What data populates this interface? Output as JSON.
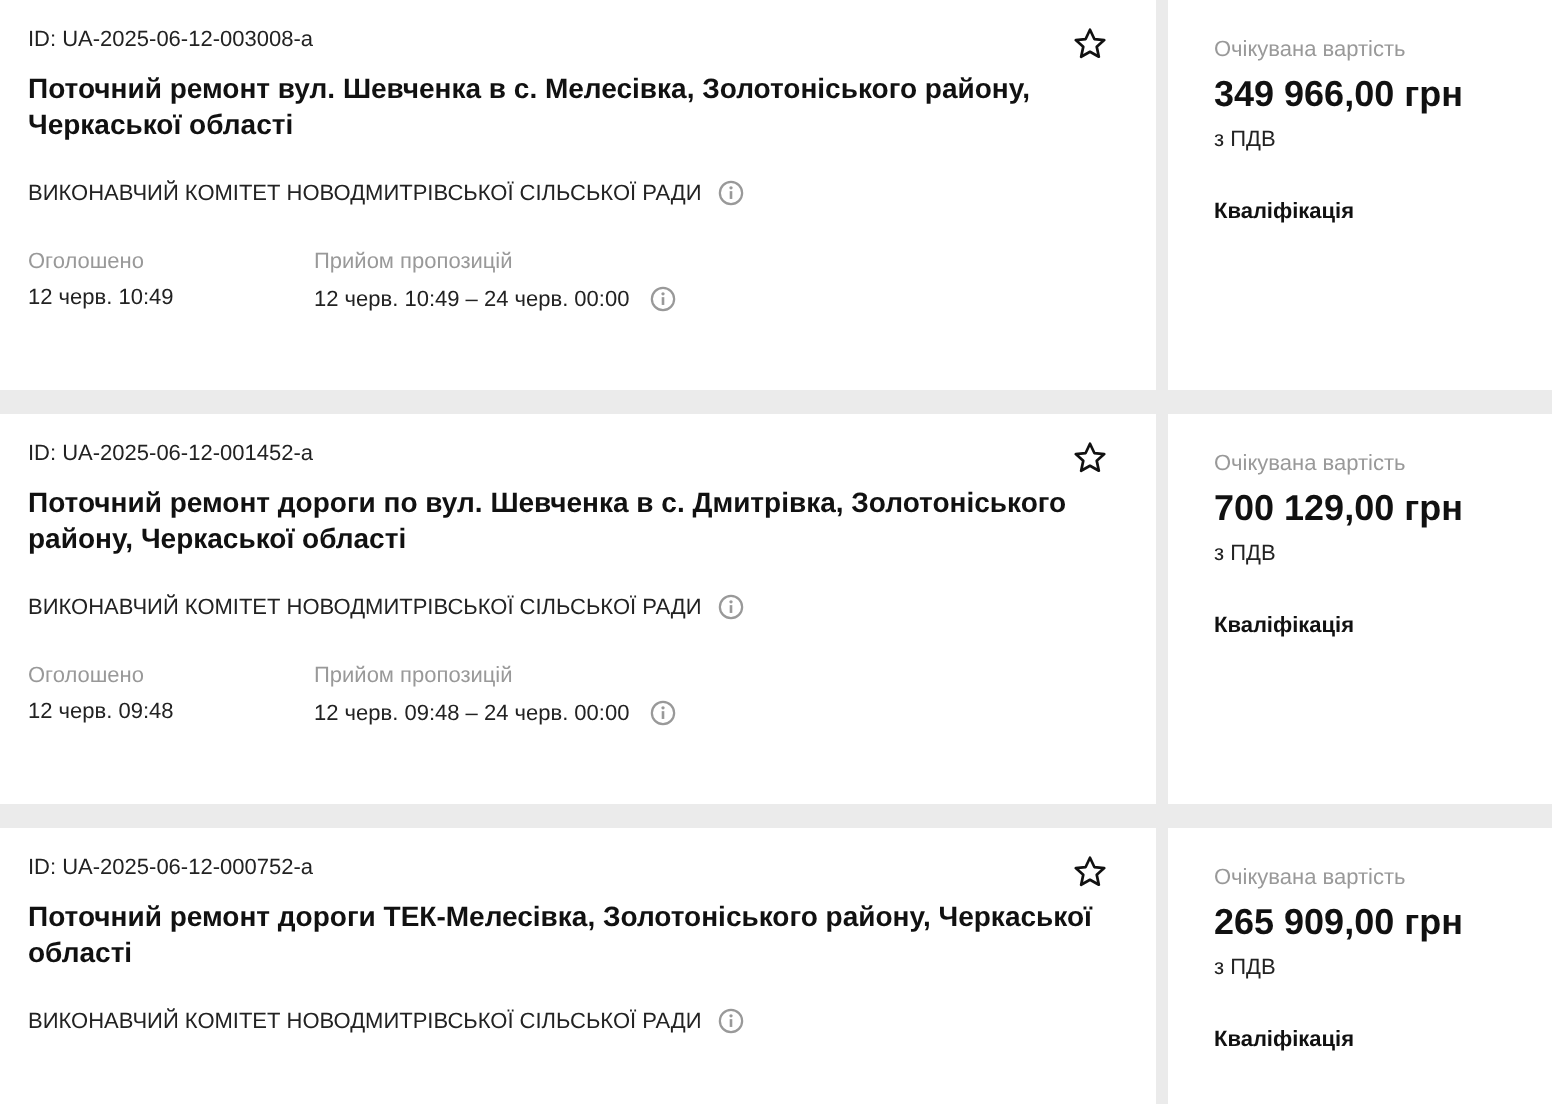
{
  "tenders": [
    {
      "id": "ID: UA-2025-06-12-003008-a",
      "favorite": false,
      "title": "Поточний ремонт вул. Шевченка в с. Мелесівка, Золотоніського району, Черкаської області",
      "organizer": "ВИКОНАВЧИЙ КОМІТЕТ НОВОДМИТРІВСЬКОЇ СІЛЬСЬКОЇ РАДИ",
      "announced_label": "Оголошено",
      "announced": "12 черв. 10:49",
      "period_label": "Прийом пропозицій",
      "period": "12 черв. 10:49 – 24 черв. 00:00",
      "value_label": "Очікувана вартість",
      "value": "349 966,00 грн",
      "vat": "з ПДВ",
      "stage": "Кваліфікація"
    },
    {
      "id": "ID: UA-2025-06-12-001452-a",
      "favorite": false,
      "title": "Поточний ремонт дороги по вул. Шевченка в с. Дмитрівка, Золотоніського району, Черкаської області",
      "organizer": "ВИКОНАВЧИЙ КОМІТЕТ НОВОДМИТРІВСЬКОЇ СІЛЬСЬКОЇ РАДИ",
      "announced_label": "Оголошено",
      "announced": "12 черв. 09:48",
      "period_label": "Прийом пропозицій",
      "period": "12 черв. 09:48 – 24 черв. 00:00",
      "value_label": "Очікувана вартість",
      "value": "700 129,00 грн",
      "vat": "з ПДВ",
      "stage": "Кваліфікація"
    },
    {
      "id": "ID: UA-2025-06-12-000752-a",
      "favorite": false,
      "title": "Поточний ремонт дороги ТЕК-Мелесівка, Золотоніського району, Черкаської області",
      "organizer": "ВИКОНАВЧИЙ КОМІТЕТ НОВОДМИТРІВСЬКОЇ СІЛЬСЬКОЇ РАДИ",
      "value_label": "Очікувана вартість",
      "value": "265 909,00 грн",
      "vat": "з ПДВ",
      "stage": "Кваліфікація"
    }
  ]
}
